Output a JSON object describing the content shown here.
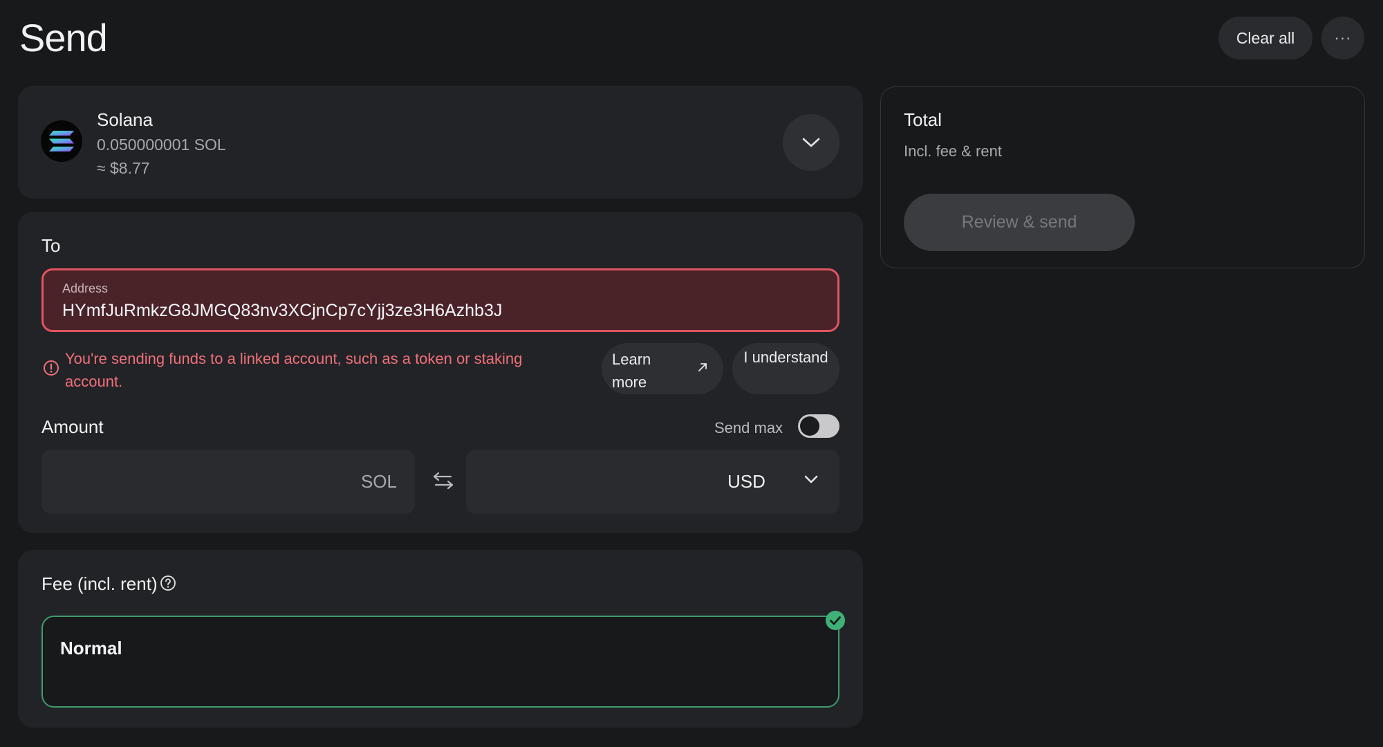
{
  "header": {
    "title": "Send",
    "clear_all_label": "Clear all",
    "more_label": "···"
  },
  "asset": {
    "name": "Solana",
    "balance": "0.050000001 SOL",
    "fiat_value": "≈ $8.77",
    "logo_icon": "solana-logo"
  },
  "to": {
    "label": "To",
    "address_caption": "Address",
    "address_value": "HYmfJuRmkzG8JMGQ83nv3XCjnCp7cYjj3ze3H6Azhb3J",
    "warning_text": "You're sending funds to a linked account, such as a token or staking account.",
    "learn_more_label": "Learn more",
    "understand_label": "I understand"
  },
  "amount": {
    "label": "Amount",
    "send_max_label": "Send max",
    "send_max_enabled": false,
    "crypto_unit": "SOL",
    "fiat_unit": "USD",
    "crypto_value": "",
    "fiat_value": ""
  },
  "fee": {
    "label": "Fee (incl. rent)",
    "selected_option": "Normal"
  },
  "total": {
    "title": "Total",
    "subtitle": "Incl. fee & rent",
    "review_label": "Review & send"
  },
  "colors": {
    "background": "#18191b",
    "card": "#222326",
    "error_border": "#e05461",
    "error_fill": "#4a2329",
    "warning_text": "#f0707b",
    "success": "#3f9b6d"
  }
}
